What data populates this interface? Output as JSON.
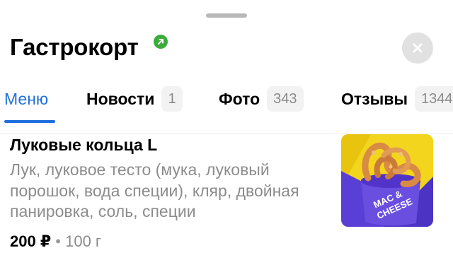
{
  "header": {
    "title": "Гастрокорт",
    "verified_icon": "verified-check-icon",
    "close_icon": "close-icon"
  },
  "tabs": [
    {
      "label": "Меню",
      "count": null,
      "active": true
    },
    {
      "label": "Новости",
      "count": "1",
      "active": false
    },
    {
      "label": "Фото",
      "count": "343",
      "active": false
    },
    {
      "label": "Отзывы",
      "count": "1344",
      "active": false
    }
  ],
  "menu_item": {
    "title": "Луковые кольца L",
    "description": "Лук, луковое тесто (мука, луковый порошок, вода специи), кляр, двойная панировка, соль, специи",
    "price": "200 ₽",
    "separator": "•",
    "weight": "100 г",
    "image_text": "MAC & CHEESE"
  },
  "colors": {
    "accent": "#1f6fdc",
    "verified": "#3dab3b",
    "photo_bg_yellow": "#f1d21a",
    "photo_bg_purple": "#5a3fd6"
  }
}
